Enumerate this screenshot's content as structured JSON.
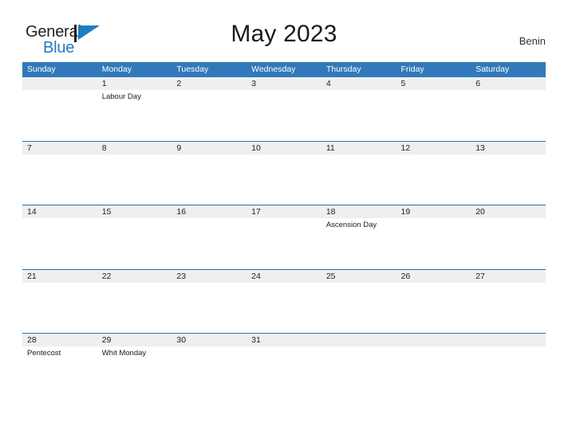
{
  "brand": {
    "name_part1": "General",
    "name_part2": "Blue",
    "logo_icon": "blue-flag-triangle-icon",
    "colors": {
      "text_dark": "#231f20",
      "blue": "#1d7cc4"
    }
  },
  "header": {
    "title": "May 2023",
    "country": "Benin"
  },
  "theme": {
    "header_blue": "#3179ba",
    "row_rule_blue": "#2e6da4",
    "date_band_gray": "#efefef",
    "page_background": "#ffffff"
  },
  "calendar": {
    "month": "May",
    "year": "2023",
    "weekday_headers": [
      "Sunday",
      "Monday",
      "Tuesday",
      "Wednesday",
      "Thursday",
      "Friday",
      "Saturday"
    ],
    "weeks": [
      {
        "days": [
          {
            "num": "",
            "events": []
          },
          {
            "num": "1",
            "events": [
              "Labour Day"
            ]
          },
          {
            "num": "2",
            "events": []
          },
          {
            "num": "3",
            "events": []
          },
          {
            "num": "4",
            "events": []
          },
          {
            "num": "5",
            "events": []
          },
          {
            "num": "6",
            "events": []
          }
        ]
      },
      {
        "days": [
          {
            "num": "7",
            "events": []
          },
          {
            "num": "8",
            "events": []
          },
          {
            "num": "9",
            "events": []
          },
          {
            "num": "10",
            "events": []
          },
          {
            "num": "11",
            "events": []
          },
          {
            "num": "12",
            "events": []
          },
          {
            "num": "13",
            "events": []
          }
        ]
      },
      {
        "days": [
          {
            "num": "14",
            "events": []
          },
          {
            "num": "15",
            "events": []
          },
          {
            "num": "16",
            "events": []
          },
          {
            "num": "17",
            "events": []
          },
          {
            "num": "18",
            "events": [
              "Ascension Day"
            ]
          },
          {
            "num": "19",
            "events": []
          },
          {
            "num": "20",
            "events": []
          }
        ]
      },
      {
        "days": [
          {
            "num": "21",
            "events": []
          },
          {
            "num": "22",
            "events": []
          },
          {
            "num": "23",
            "events": []
          },
          {
            "num": "24",
            "events": []
          },
          {
            "num": "25",
            "events": []
          },
          {
            "num": "26",
            "events": []
          },
          {
            "num": "27",
            "events": []
          }
        ]
      },
      {
        "days": [
          {
            "num": "28",
            "events": [
              "Pentecost"
            ]
          },
          {
            "num": "29",
            "events": [
              "Whit Monday"
            ]
          },
          {
            "num": "30",
            "events": []
          },
          {
            "num": "31",
            "events": []
          },
          {
            "num": "",
            "events": []
          },
          {
            "num": "",
            "events": []
          },
          {
            "num": "",
            "events": []
          }
        ]
      }
    ]
  }
}
